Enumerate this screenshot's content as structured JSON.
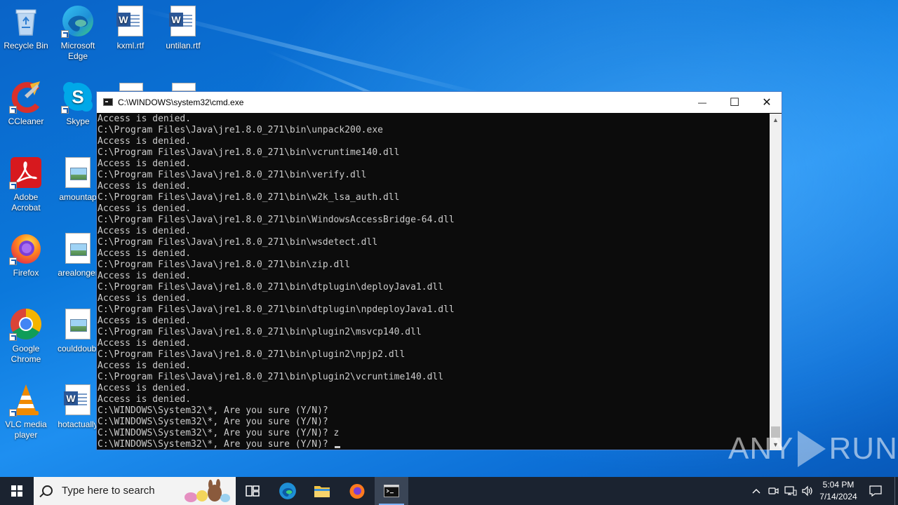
{
  "desktop": {
    "icons": [
      {
        "label": "Recycle Bin",
        "icon": "recycle-bin-icon"
      },
      {
        "label": "Microsoft Edge",
        "icon": "edge-icon"
      },
      {
        "label": "kxml.rtf",
        "icon": "word-document-icon"
      },
      {
        "label": "untilan.rtf",
        "icon": "word-document-icon"
      },
      {
        "label": "CCleaner",
        "icon": "ccleaner-icon"
      },
      {
        "label": "Skype",
        "icon": "skype-icon"
      },
      {
        "label": "Adobe Acrobat",
        "icon": "acrobat-icon"
      },
      {
        "label": "amountap",
        "icon": "image-document-icon"
      },
      {
        "label": "Firefox",
        "icon": "firefox-icon"
      },
      {
        "label": "arealonger",
        "icon": "image-document-icon"
      },
      {
        "label": "Google Chrome",
        "icon": "chrome-icon"
      },
      {
        "label": "coulddoubl",
        "icon": "image-document-icon"
      },
      {
        "label": "VLC media player",
        "icon": "vlc-icon"
      },
      {
        "label": "hotactually",
        "icon": "word-document-icon"
      }
    ]
  },
  "cmd_window": {
    "title": "C:\\WINDOWS\\system32\\cmd.exe",
    "minimize_glyph": "—",
    "maximize_glyph": "☐",
    "close_glyph": "✕",
    "scroll_up_glyph": "▲",
    "scroll_down_glyph": "▼",
    "lines": [
      "Access is denied.",
      "C:\\Program Files\\Java\\jre1.8.0_271\\bin\\unpack200.exe",
      "Access is denied.",
      "C:\\Program Files\\Java\\jre1.8.0_271\\bin\\vcruntime140.dll",
      "Access is denied.",
      "C:\\Program Files\\Java\\jre1.8.0_271\\bin\\verify.dll",
      "Access is denied.",
      "C:\\Program Files\\Java\\jre1.8.0_271\\bin\\w2k_lsa_auth.dll",
      "Access is denied.",
      "C:\\Program Files\\Java\\jre1.8.0_271\\bin\\WindowsAccessBridge-64.dll",
      "Access is denied.",
      "C:\\Program Files\\Java\\jre1.8.0_271\\bin\\wsdetect.dll",
      "Access is denied.",
      "C:\\Program Files\\Java\\jre1.8.0_271\\bin\\zip.dll",
      "Access is denied.",
      "C:\\Program Files\\Java\\jre1.8.0_271\\bin\\dtplugin\\deployJava1.dll",
      "Access is denied.",
      "C:\\Program Files\\Java\\jre1.8.0_271\\bin\\dtplugin\\npdeployJava1.dll",
      "Access is denied.",
      "C:\\Program Files\\Java\\jre1.8.0_271\\bin\\plugin2\\msvcp140.dll",
      "Access is denied.",
      "C:\\Program Files\\Java\\jre1.8.0_271\\bin\\plugin2\\npjp2.dll",
      "Access is denied.",
      "C:\\Program Files\\Java\\jre1.8.0_271\\bin\\plugin2\\vcruntime140.dll",
      "Access is denied.",
      "Access is denied.",
      "C:\\WINDOWS\\System32\\*, Are you sure (Y/N)?",
      "C:\\WINDOWS\\System32\\*, Are you sure (Y/N)?",
      "C:\\WINDOWS\\System32\\*, Are you sure (Y/N)? z",
      "C:\\WINDOWS\\System32\\*, Are you sure (Y/N)?"
    ]
  },
  "watermark": {
    "left": "ANY",
    "right": "RUN"
  },
  "taskbar": {
    "search_placeholder": "Type here to search",
    "pinned": [
      {
        "name": "task-view",
        "icon": "task-view-icon"
      },
      {
        "name": "edge",
        "icon": "edge-icon"
      },
      {
        "name": "file-explorer",
        "icon": "folder-icon"
      },
      {
        "name": "firefox",
        "icon": "firefox-icon"
      },
      {
        "name": "cmd",
        "icon": "cmd-icon",
        "active": true
      }
    ],
    "clock_time": "5:04 PM",
    "clock_date": "7/14/2024"
  },
  "colors": {
    "console_bg": "#0c0c0c",
    "console_text": "#cccccc",
    "taskbar_bg": "#1b2330",
    "accent": "#0b78db"
  }
}
